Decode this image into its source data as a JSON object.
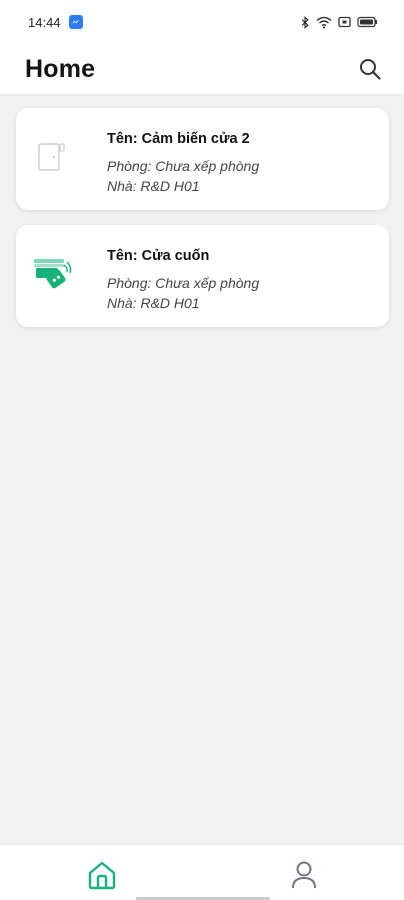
{
  "status_bar": {
    "time": "14:44",
    "notification_icon": "messenger-icon",
    "system_icons": [
      "bluetooth-icon",
      "wifi-icon",
      "screen-icon",
      "battery-icon"
    ]
  },
  "app_bar": {
    "title": "Home",
    "search_icon": "search-icon"
  },
  "devices": [
    {
      "name": "Tên: Cảm biến cửa 2",
      "room": "Phòng: Chưa xếp phòng",
      "house": "Nhà: R&D H01",
      "icon": "door-sensor-icon"
    },
    {
      "name": "Tên: Cửa cuốn",
      "room": "Phòng: Chưa xếp phòng",
      "house": "Nhà: R&D H01",
      "icon": "roller-door-remote-icon"
    }
  ],
  "bottom_nav": {
    "items": [
      {
        "icon": "home-icon",
        "active": true
      },
      {
        "icon": "profile-icon",
        "active": false
      }
    ]
  },
  "colors": {
    "accent": "#17b27a",
    "background": "#f1f1f1",
    "inactive_icon": "#6f7585"
  }
}
